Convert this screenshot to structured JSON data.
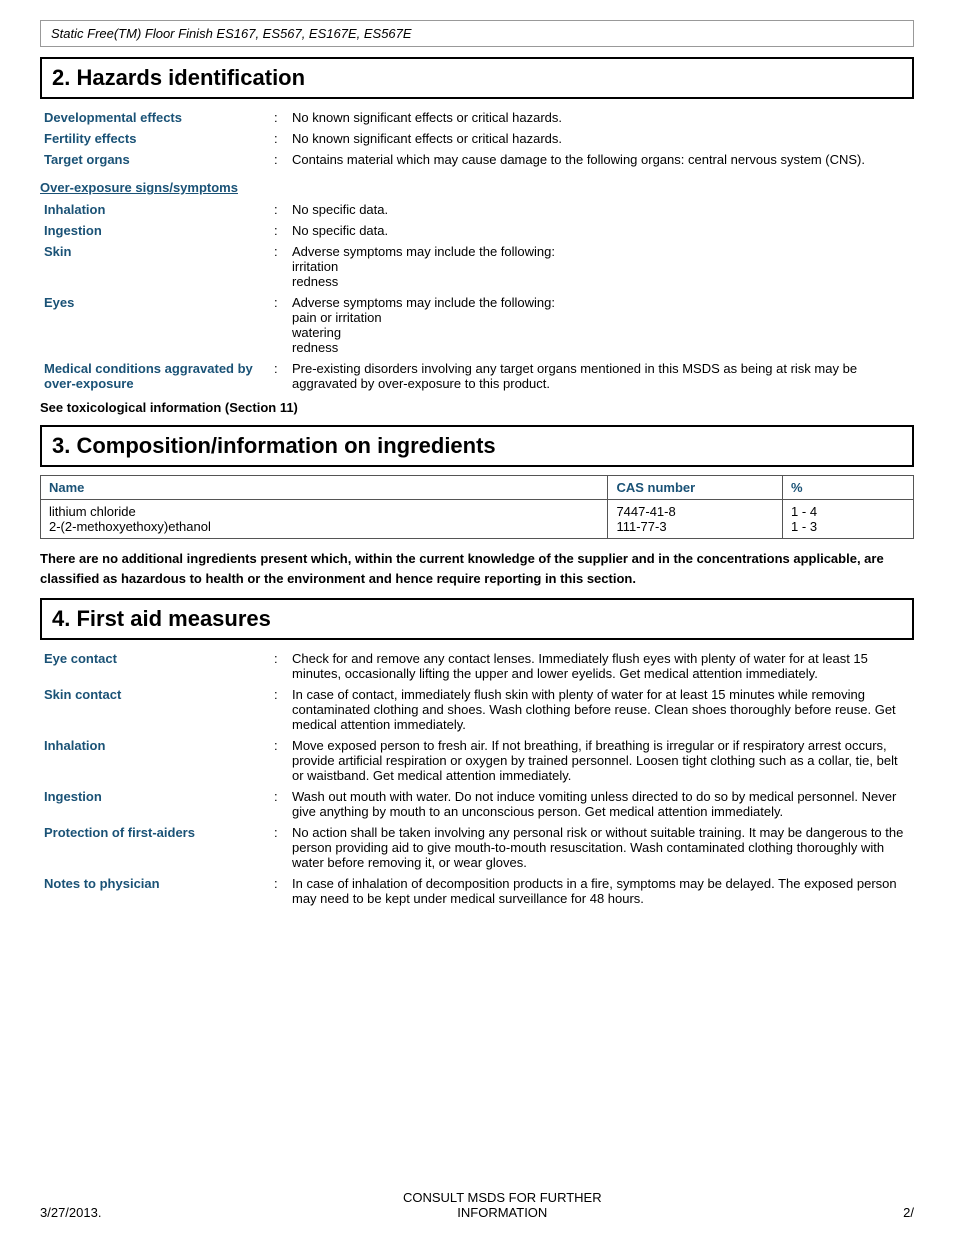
{
  "header": {
    "title": "Static Free(TM) Floor Finish ES167, ES567, ES167E, ES567E"
  },
  "section2": {
    "heading": "2. Hazards identification",
    "rows": [
      {
        "label": "Developmental effects",
        "value": "No known significant effects or critical hazards."
      },
      {
        "label": "Fertility effects",
        "value": "No known significant effects or critical hazards."
      },
      {
        "label": "Target organs",
        "value": "Contains material which may cause damage to the following organs: central nervous system (CNS)."
      }
    ],
    "overexposure_link": "Over-exposure signs/symptoms",
    "symptoms_rows": [
      {
        "label": "Inhalation",
        "value": "No specific data."
      },
      {
        "label": "Ingestion",
        "value": "No specific data."
      },
      {
        "label": "Skin",
        "value": "Adverse symptoms may include the following:\nirritation\nredness"
      },
      {
        "label": "Eyes",
        "value": "Adverse symptoms may include the following:\npain or irritation\nwatering\nredness"
      },
      {
        "label": "Medical conditions aggravated by over-exposure",
        "value": "Pre-existing disorders involving any target organs mentioned in this MSDS as being at risk may be aggravated by over-exposure to this product."
      }
    ],
    "see_note": "See toxicological information (Section 11)"
  },
  "section3": {
    "heading": "3. Composition/information on ingredients",
    "table_headers": [
      "Name",
      "CAS number",
      "%"
    ],
    "ingredients": [
      {
        "name": "lithium chloride",
        "cas": "7447-41-8",
        "pct": "1 - 4"
      },
      {
        "name": "2-(2-methoxyethoxy)ethanol",
        "cas": "111-77-3",
        "pct": "1 - 3"
      }
    ],
    "note": "There are no additional ingredients present which, within the current knowledge of the supplier and in the concentrations applicable, are classified as hazardous to health or the environment and hence require reporting in this section."
  },
  "section4": {
    "heading": "4. First aid measures",
    "rows": [
      {
        "label": "Eye contact",
        "value": "Check for and remove any contact lenses.  Immediately flush eyes with plenty of water for at least 15 minutes, occasionally lifting the upper and lower eyelids.  Get medical attention immediately."
      },
      {
        "label": "Skin contact",
        "value": "In case of contact, immediately flush skin with plenty of water for at least 15 minutes while removing contaminated clothing and shoes.  Wash clothing before reuse.  Clean shoes thoroughly before reuse.  Get medical attention immediately."
      },
      {
        "label": "Inhalation",
        "value": "Move exposed person to fresh air.  If not breathing, if breathing is irregular or if respiratory arrest occurs, provide artificial respiration or oxygen by trained personnel.  Loosen tight clothing such as a collar, tie, belt or waistband.  Get medical attention immediately."
      },
      {
        "label": "Ingestion",
        "value": "Wash out mouth with water.  Do not induce vomiting unless directed to do so by medical personnel.  Never give anything by mouth to an unconscious person.  Get medical attention immediately."
      },
      {
        "label": "Protection of first-aiders",
        "value": "No action shall be taken involving any personal risk or without suitable training.  It may be dangerous to the person providing aid to give mouth-to-mouth resuscitation.  Wash contaminated clothing thoroughly with water before removing it, or wear gloves."
      },
      {
        "label": "Notes to physician",
        "value": "In case of inhalation of decomposition products in a fire, symptoms may be delayed.  The exposed person may need to be kept under medical surveillance for 48 hours."
      }
    ]
  },
  "footer": {
    "date": "3/27/2013.",
    "center": "CONSULT MSDS FOR FURTHER\nINFORMATION",
    "page": "2/"
  }
}
